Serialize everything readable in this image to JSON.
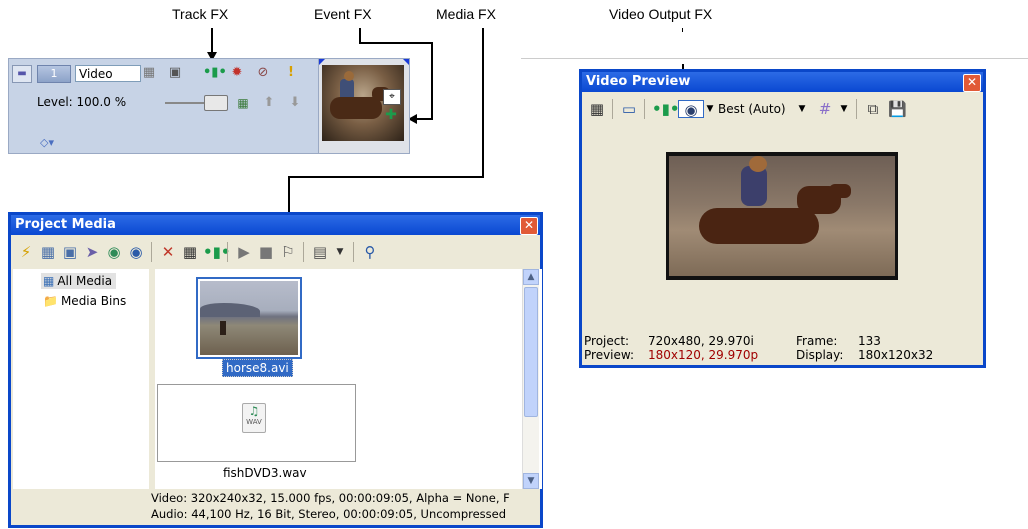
{
  "callouts": {
    "track_fx": "Track FX",
    "event_fx": "Event FX",
    "media_fx": "Media FX",
    "video_output_fx": "Video Output FX"
  },
  "track": {
    "number": "1",
    "name": "Video",
    "level": "Level: 100.0 %"
  },
  "project_media": {
    "title": "Project Media",
    "tree": [
      "All Media",
      "Media Bins"
    ],
    "files": [
      {
        "name": "horse8.avi",
        "selected": true
      },
      {
        "name": "fishDVD3.wav",
        "selected": false
      }
    ],
    "wav_label": "WAV",
    "status": [
      "Video: 320x240x32, 15.000 fps, 00:00:09:05, Alpha = None, F",
      "Audio: 44,100 Hz, 16 Bit, Stereo, 00:00:09:05, Uncompressed"
    ]
  },
  "video_preview": {
    "title": "Video Preview",
    "quality": "Best (Auto)",
    "project_label": "Project:",
    "project_value": "720x480, 29.970i",
    "preview_label": "Preview:",
    "preview_value": "180x120, 29.970p",
    "frame_label": "Frame:",
    "frame_value": "133",
    "display_label": "Display:",
    "display_value": "180x120x32"
  },
  "colors": {
    "title_blue": "#0a48d2",
    "preview_red": "#a00000",
    "selection": "#316ac5"
  }
}
